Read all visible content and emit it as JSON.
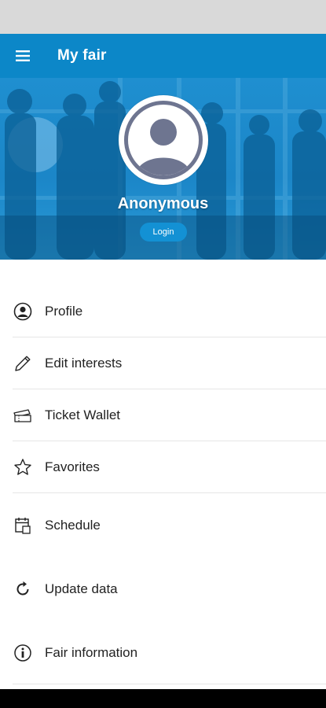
{
  "app_bar": {
    "title": "My fair",
    "menu_icon": "hamburger-icon"
  },
  "profile": {
    "name": "Anonymous",
    "login_label": "Login",
    "avatar_icon": "user-avatar-icon"
  },
  "menu": {
    "items": [
      {
        "label": "Profile",
        "icon": "person-circle-icon"
      },
      {
        "label": "Edit interests",
        "icon": "pencil-icon"
      },
      {
        "label": "Ticket Wallet",
        "icon": "ticket-icon"
      },
      {
        "label": "Favorites",
        "icon": "star-icon"
      },
      {
        "label": "Schedule",
        "icon": "calendar-icon"
      },
      {
        "label": "Update data",
        "icon": "refresh-icon"
      },
      {
        "label": "Fair information",
        "icon": "info-icon"
      }
    ]
  },
  "colors": {
    "primary": "#0c87c8",
    "button": "#1391d4",
    "avatar_ring": "#6e7590"
  }
}
